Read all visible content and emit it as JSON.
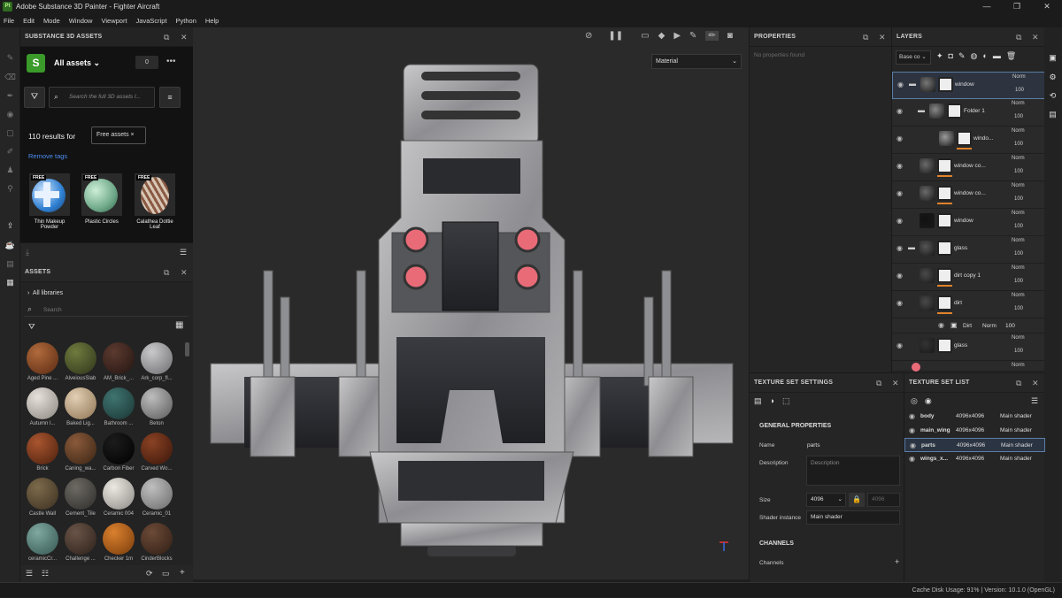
{
  "app": {
    "logo": "Pt",
    "title": "Adobe Substance 3D Painter - Fighter Aircraft",
    "min": "—",
    "max": "❐",
    "close": "✕"
  },
  "menu": [
    "File",
    "Edit",
    "Mode",
    "Window",
    "Viewport",
    "JavaScript",
    "Python",
    "Help"
  ],
  "assets3d": {
    "title": "SUBSTANCE 3D ASSETS",
    "scope": "All assets",
    "count": "0",
    "search_placeholder": "Search the full 3D assets l...",
    "results": "110 results for",
    "tag": "Free assets",
    "remove": "Remove tags",
    "badge": "FREE",
    "items": [
      {
        "name": "Thin Makeup Powder"
      },
      {
        "name": "Plastic Circles"
      },
      {
        "name": "Calathea Dottie Leaf"
      }
    ]
  },
  "assets": {
    "title": "ASSETS",
    "libraries": "All libraries",
    "search_placeholder": "Search",
    "materials": [
      "Aged Pine ...",
      "AlveiousSlab",
      "AM_Brick_...",
      "Ark_corp_fl...",
      "Autumn l...",
      "Baked Lig...",
      "Bathroom ...",
      "Beton",
      "Brick",
      "Caning_wa...",
      "Carbon Fiber",
      "Carved Wo...",
      "Castle Wall",
      "Cement_Tile",
      "Ceramic 004",
      "Ceramic_01",
      "ceramicCr...",
      "Challenge ...",
      "Checker 1m",
      "CinderBlocks"
    ]
  },
  "viewport": {
    "mode": "Material"
  },
  "properties": {
    "title": "PROPERTIES",
    "empty": "No properties found"
  },
  "layers": {
    "title": "LAYERS",
    "channel": "Base co",
    "rows": [
      {
        "name": "window",
        "blend": "Norm",
        "op": "100"
      },
      {
        "name": "Folder 1",
        "blend": "Norm",
        "op": "100"
      },
      {
        "name": "windo...",
        "blend": "Norm",
        "op": "100"
      },
      {
        "name": "window co...",
        "blend": "Norm",
        "op": "100"
      },
      {
        "name": "window co...",
        "blend": "Norm",
        "op": "100"
      },
      {
        "name": "window",
        "blend": "Norm",
        "op": "100"
      },
      {
        "name": "glass",
        "blend": "Norm",
        "op": "100"
      },
      {
        "name": "dirt copy 1",
        "blend": "Norm",
        "op": "100"
      },
      {
        "name": "dirt",
        "blend": "Norm",
        "op": "100"
      },
      {
        "name": "glass",
        "blend": "Norm",
        "op": "100"
      }
    ],
    "effect": {
      "name": "Dirt",
      "blend": "Norm",
      "op": "100"
    },
    "partial": "Norm"
  },
  "tss": {
    "title": "TEXTURE SET SETTINGS",
    "general": "GENERAL PROPERTIES",
    "name_label": "Name",
    "name_value": "parts",
    "desc_label": "Description",
    "desc_placeholder": "Description",
    "size_label": "Size",
    "size_value": "4096",
    "size_locked": "4096",
    "shader_label": "Shader instance",
    "shader_value": "Main shader",
    "channels_head": "CHANNELS",
    "channels_label": "Channels"
  },
  "tsl": {
    "title": "TEXTURE SET LIST",
    "rows": [
      {
        "name": "body",
        "res": "4096x4096",
        "shader": "Main shader"
      },
      {
        "name": "main_wing",
        "res": "4096x4096",
        "shader": "Main shader"
      },
      {
        "name": "parts",
        "res": "4096x4096",
        "shader": "Main shader"
      },
      {
        "name": "wings_x...",
        "res": "4096x4096",
        "shader": "Main shader"
      }
    ]
  },
  "status": "Cache Disk Usage:   91% | Version: 10.1.0 (OpenGL)"
}
